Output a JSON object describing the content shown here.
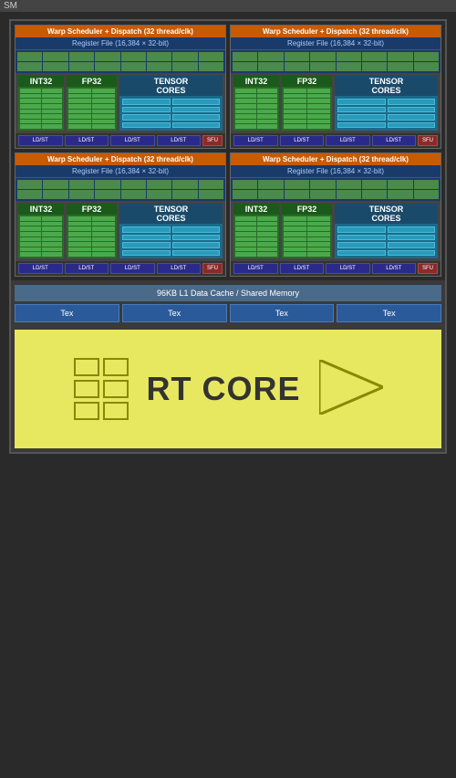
{
  "sm": {
    "label": "SM",
    "quadrants": [
      {
        "id": "q1",
        "warp_label": "Warp Scheduler + Dispatch (32 thread/clk)",
        "register_label": "Register File (16,384 × 32-bit)",
        "int32_label": "INT32",
        "fp32_label": "FP32",
        "tensor_label": "TENSOR\nCORES"
      },
      {
        "id": "q2",
        "warp_label": "Warp Scheduler + Dispatch (32 thread/clk)",
        "register_label": "Register File (16,384 × 32-bit)",
        "int32_label": "INT32",
        "fp32_label": "FP32",
        "tensor_label": "TENSOR\nCORES"
      },
      {
        "id": "q3",
        "warp_label": "Warp Scheduler + Dispatch (32 thread/clk)",
        "register_label": "Register File (16,384 × 32-bit)",
        "int32_label": "INT32",
        "fp32_label": "FP32",
        "tensor_label": "TENSOR\nCORES"
      },
      {
        "id": "q4",
        "warp_label": "Warp Scheduler + Dispatch (32 thread/clk)",
        "register_label": "Register File (16,384 × 32-bit)",
        "int32_label": "INT32",
        "fp32_label": "FP32",
        "tensor_label": "TENSOR\nCORES"
      }
    ],
    "ldst_labels": [
      "LD/ST",
      "LD/ST",
      "LD/ST",
      "LD/ST"
    ],
    "sfu_label": "SFU",
    "l1_cache_label": "96KB L1 Data Cache / Shared Memory",
    "tex_labels": [
      "Tex",
      "Tex",
      "Tex",
      "Tex"
    ],
    "rt_core_label": "RT CORE"
  }
}
